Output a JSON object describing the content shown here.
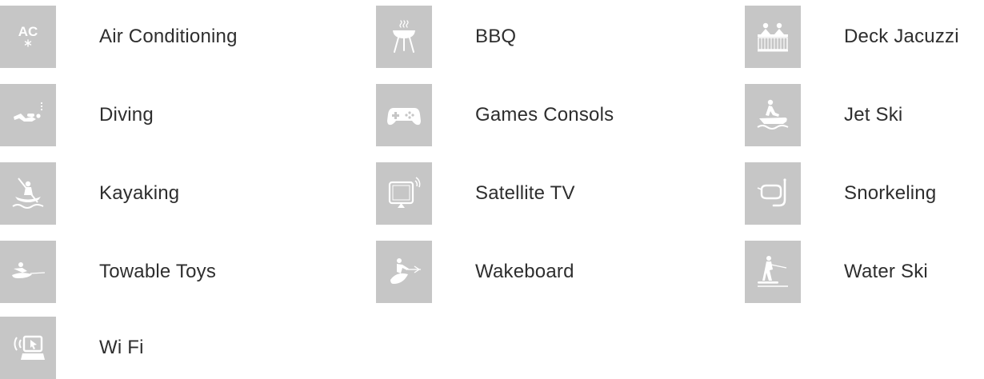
{
  "amenities": [
    {
      "label": "Air Conditioning",
      "icon": "air-conditioning-icon"
    },
    {
      "label": "BBQ",
      "icon": "bbq-icon"
    },
    {
      "label": "Deck Jacuzzi",
      "icon": "deck-jacuzzi-icon"
    },
    {
      "label": "Diving",
      "icon": "diving-icon"
    },
    {
      "label": "Games Consols",
      "icon": "game-controller-icon"
    },
    {
      "label": "Jet Ski",
      "icon": "jet-ski-icon"
    },
    {
      "label": "Kayaking",
      "icon": "kayak-icon"
    },
    {
      "label": "Satellite TV",
      "icon": "satellite-tv-icon"
    },
    {
      "label": "Snorkeling",
      "icon": "snorkel-mask-icon"
    },
    {
      "label": "Towable Toys",
      "icon": "towable-toy-icon"
    },
    {
      "label": "Wakeboard",
      "icon": "wakeboard-icon"
    },
    {
      "label": "Water Ski",
      "icon": "water-ski-icon"
    },
    {
      "label": "Wi Fi",
      "icon": "wifi-laptop-icon"
    }
  ],
  "icons": {
    "ac_text": "AC"
  },
  "colors": {
    "icon_background": "#c6c6c6",
    "icon_foreground": "#ffffff",
    "label_text": "#2e2e2e"
  }
}
